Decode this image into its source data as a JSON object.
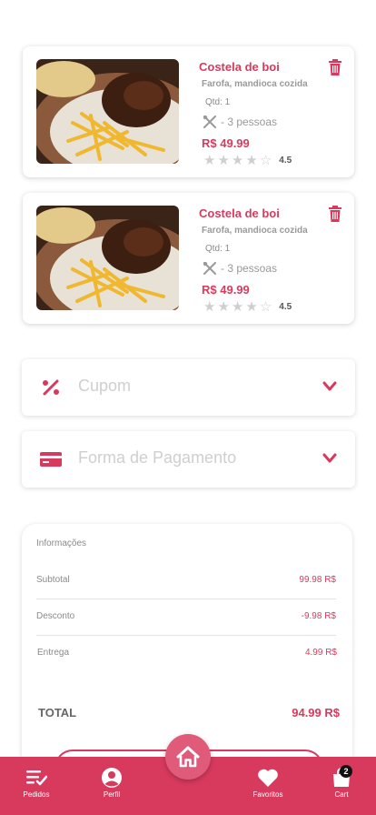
{
  "cart_items": [
    {
      "title": "Costela de boi",
      "description": "Farofa, mandioca cozida",
      "quantity": "Qtd: 1",
      "serves": "- 3 pessoas",
      "price": "R$ 49.99",
      "rating": "4.5"
    },
    {
      "title": "Costela de boi",
      "description": "Farofa, mandioca cozida",
      "quantity": "Qtd: 1",
      "serves": "- 3 pessoas",
      "price": "R$ 49.99",
      "rating": "4.5"
    }
  ],
  "coupon": {
    "label": "Cupom"
  },
  "payment": {
    "label": "Forma de Pagamento"
  },
  "info": {
    "heading": "Informações",
    "subtotal_label": "Subtotal",
    "subtotal_value": "99.98 R$",
    "discount_label": "Desconto",
    "discount_value": "-9.98 R$",
    "delivery_label": "Entrega",
    "delivery_value": "4.99 R$",
    "total_label": "TOTAL",
    "total_value": "94.99 R$"
  },
  "tabbar": {
    "orders_label": "Pedidos",
    "profile_label": "Perfil",
    "favorites_label": "Favoritos",
    "cart_label": "Cart",
    "cart_badge": "2"
  },
  "colors": {
    "accent": "#d83a5e",
    "accent_light": "#e05a79"
  },
  "icons": [
    "trash-icon",
    "cutlery-icon",
    "star-icon",
    "percent-icon",
    "credit-card-icon",
    "chevron-down-icon",
    "list-check-icon",
    "user-circle-icon",
    "home-icon",
    "heart-icon",
    "shopping-bag-icon"
  ]
}
